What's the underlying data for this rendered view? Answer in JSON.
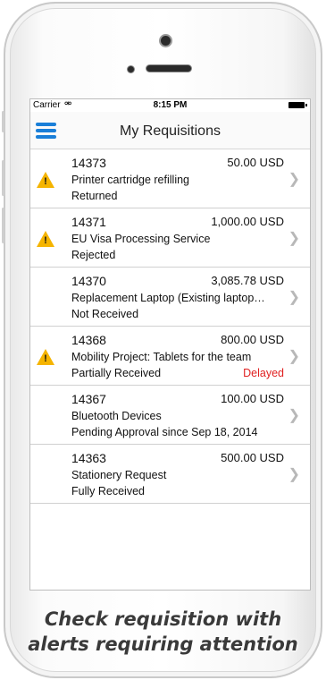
{
  "status_bar": {
    "carrier": "Carrier",
    "time": "8:15 PM"
  },
  "header": {
    "title": "My Requisitions"
  },
  "requisitions": [
    {
      "id": "14373",
      "amount": "50.00 USD",
      "description": "Printer cartridge refilling",
      "status": "Returned",
      "flag": "",
      "alert": true
    },
    {
      "id": "14371",
      "amount": "1,000.00 USD",
      "description": "EU Visa Processing Service",
      "status": "Rejected",
      "flag": "",
      "alert": true
    },
    {
      "id": "14370",
      "amount": "3,085.78 USD",
      "description": "Replacement Laptop (Existing laptop…",
      "status": "Not Received",
      "flag": "",
      "alert": false
    },
    {
      "id": "14368",
      "amount": "800.00 USD",
      "description": "Mobility Project: Tablets for the team",
      "status": "Partially Received",
      "flag": "Delayed",
      "alert": true
    },
    {
      "id": "14367",
      "amount": "100.00 USD",
      "description": "Bluetooth Devices",
      "status": "Pending Approval since Sep 18, 2014",
      "flag": "",
      "alert": false
    },
    {
      "id": "14363",
      "amount": "500.00 USD",
      "description": "Stationery Request",
      "status": "Fully Received",
      "flag": "",
      "alert": false
    }
  ],
  "caption": {
    "line1": "Check requisition  with",
    "line2": "alerts requiring attention"
  },
  "icons": {
    "alert": "warning-triangle-icon",
    "menu": "hamburger-menu-icon",
    "chevron": "chevron-right-icon"
  },
  "colors": {
    "accent": "#1a7fd8",
    "warning": "#f5b400",
    "delayed": "#e02020"
  }
}
